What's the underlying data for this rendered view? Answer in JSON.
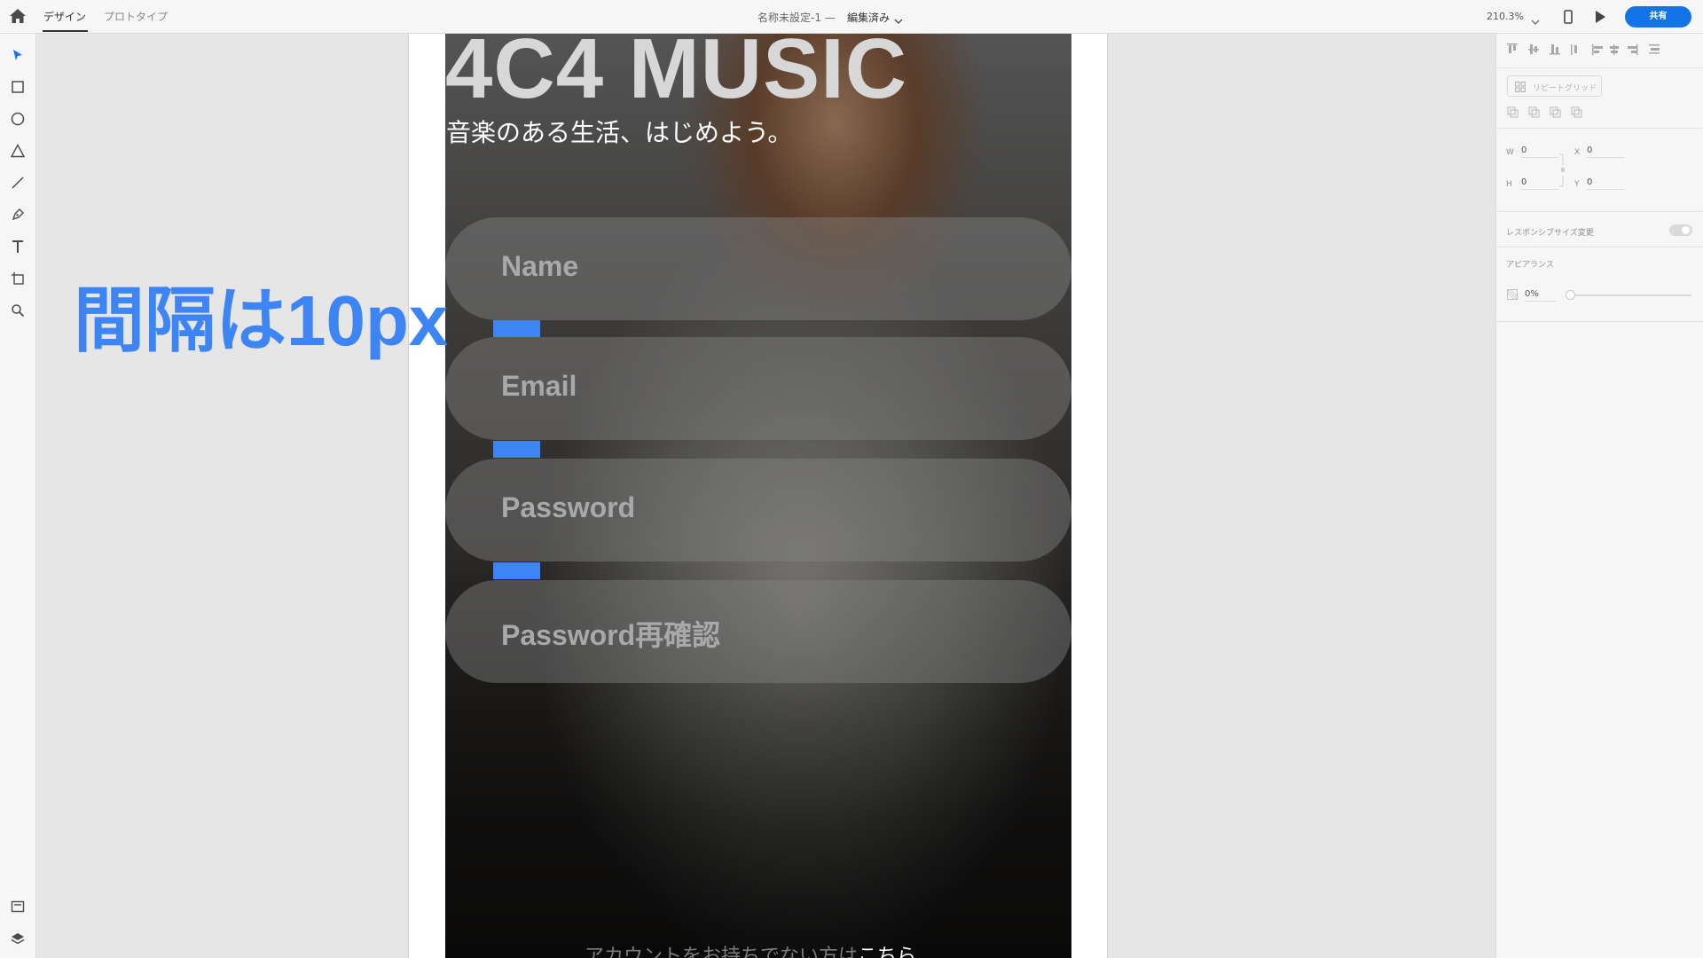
{
  "topbar": {
    "tabs": [
      {
        "label": "デザイン",
        "active": true
      },
      {
        "label": "プロトタイプ",
        "active": false
      }
    ],
    "document_title": "名称未設定-1 —",
    "document_status": "編集済み",
    "zoom": "210.3%",
    "share_label": "共有"
  },
  "toolbar": {
    "tools": [
      "select-icon",
      "rectangle-icon",
      "ellipse-icon",
      "triangle-icon",
      "line-icon",
      "pen-icon",
      "text-icon",
      "artboard-icon",
      "zoom-icon"
    ],
    "bottom_tools": [
      "assets-icon",
      "layers-icon"
    ]
  },
  "canvas": {
    "logo": "4C4 MUSIC",
    "tagline": "音楽のある生活、はじめよう。",
    "fields": [
      {
        "placeholder": "Name"
      },
      {
        "placeholder": "Email"
      },
      {
        "placeholder": "Password"
      },
      {
        "placeholder": "Password再確認"
      }
    ],
    "annotation": "間隔は10px",
    "footer_text": "アカウントをお持ちでない方は",
    "footer_link": "こちら",
    "accent_color": "#3d84f5"
  },
  "right_panel": {
    "repeat_grid_label": "リピートグリッド",
    "w_label": "W",
    "w_value": "0",
    "x_label": "X",
    "x_value": "0",
    "h_label": "H",
    "h_value": "0",
    "y_label": "Y",
    "y_value": "0",
    "responsive_resize_label": "レスポンシブサイズ変更",
    "appearance_label": "アピアランス",
    "opacity_value": "0%"
  }
}
